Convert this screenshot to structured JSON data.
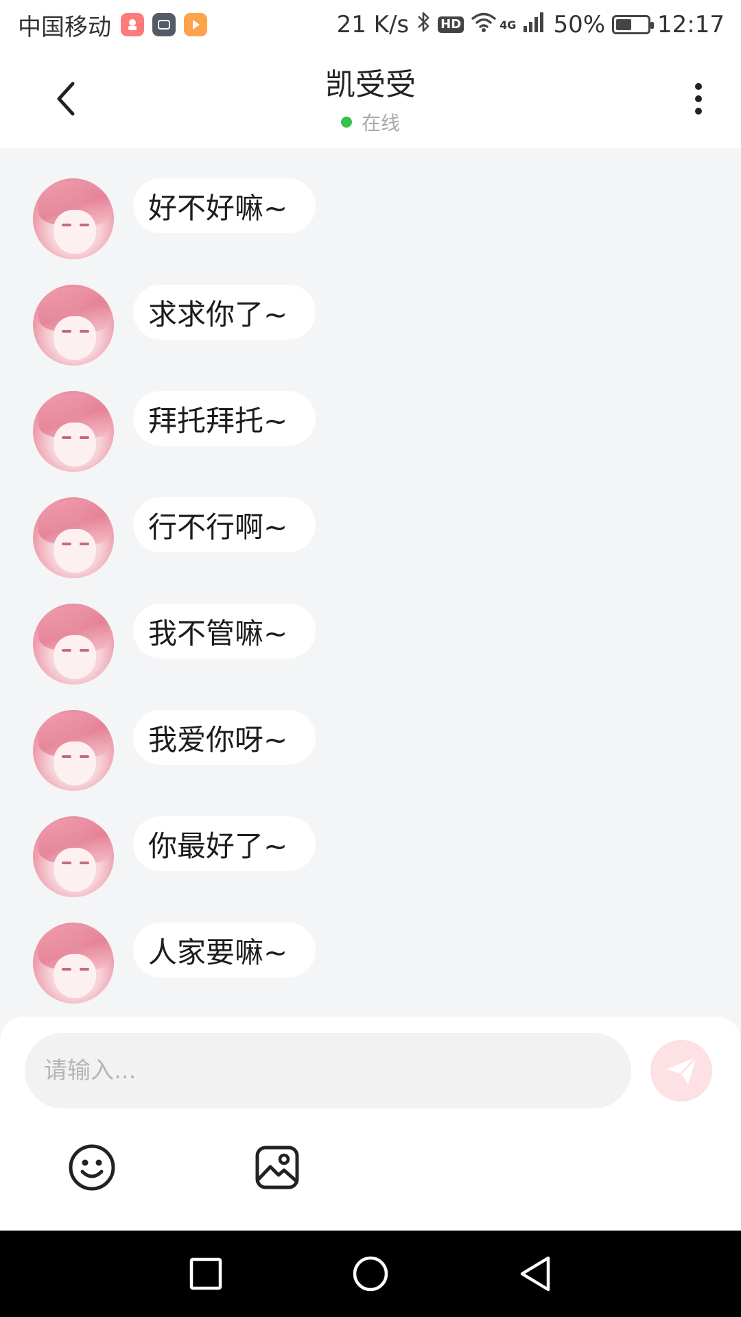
{
  "status_bar": {
    "carrier": "中国移动",
    "net_speed": "21 K/s",
    "hd_label": "HD",
    "network_type": "4G",
    "battery": "50%",
    "battery_level": 0.5,
    "time": "12:17"
  },
  "header": {
    "title": "凯受受",
    "status": "在线",
    "status_color": "#34c24a"
  },
  "messages": [
    {
      "text": "好不好嘛~",
      "direction": "incoming"
    },
    {
      "text": "求求你了~",
      "direction": "incoming"
    },
    {
      "text": "拜托拜托~",
      "direction": "incoming"
    },
    {
      "text": "行不行啊~",
      "direction": "incoming"
    },
    {
      "text": "我不管嘛~",
      "direction": "incoming"
    },
    {
      "text": "我爱你呀~",
      "direction": "incoming"
    },
    {
      "text": "你最好了~",
      "direction": "incoming"
    },
    {
      "text": "人家要嘛~",
      "direction": "incoming"
    }
  ],
  "composer": {
    "placeholder": "请输入...",
    "value": "",
    "send_icon": "paper-plane-icon",
    "send_color": "#fde1e4"
  },
  "toolbar": {
    "emoji_icon": "smiley-icon",
    "image_icon": "image-icon"
  },
  "icons": {
    "back": "chevron-left-icon",
    "more": "more-vertical-icon"
  },
  "colors": {
    "background": "#f4f5f7",
    "bubble": "#ffffff",
    "avatar_accent": "#e8899c"
  }
}
